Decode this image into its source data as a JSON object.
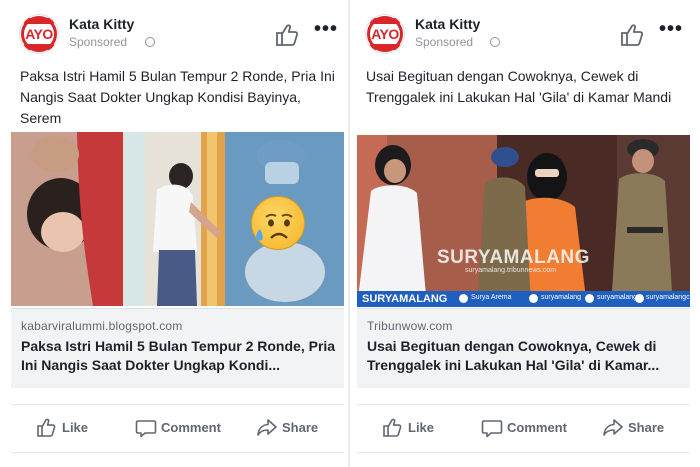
{
  "posts": [
    {
      "page_name": "Kata Kitty",
      "sponsored": "Sponsored",
      "avatar_text": "AYO",
      "caption": "Paksa Istri Hamil 5 Bulan Tempur 2 Ronde, Pria Ini Nangis Saat Dokter Ungkap Kondisi Bayinya, Serem",
      "link_domain": "kabarviralummi.blogspot.com",
      "link_title": "Paksa Istri Hamil 5 Bulan Tempur 2 Ronde, Pria Ini Nangis Saat Dokter Ungkap Kondi...",
      "actions": {
        "like": "Like",
        "comment": "Comment",
        "share": "Share"
      }
    },
    {
      "page_name": "Kata Kitty",
      "sponsored": "Sponsored",
      "avatar_text": "AYO",
      "caption": "Usai Begituan dengan Cowoknya, Cewek di Trenggalek ini Lakukan Hal 'Gila' di Kamar Mandi",
      "link_domain": "Tribunwow.com",
      "link_title": "Usai Begituan dengan Cowoknya, Cewek di Trenggalek ini Lakukan Hal 'Gila' di Kamar...",
      "watermark": "SURYAMALANG",
      "watermark_url": "suryamalang.tribunnews.com",
      "banner": {
        "brand": "SURYAMALANG",
        "facebook": "Surya Arema",
        "twitter": "suryamalang",
        "instagram": "suryamalang",
        "web": "suryamalangcom"
      },
      "actions": {
        "like": "Like",
        "comment": "Comment",
        "share": "Share"
      }
    }
  ],
  "colors": {
    "brand_red": "#d8262b",
    "text": "#1d2129",
    "secondary": "#90949c",
    "link_box": "#f2f3f5",
    "banner_blue": "#1f5fbf"
  },
  "icons": [
    "thumbs-up-icon",
    "more-horizontal-icon",
    "globe-icon",
    "comment-icon",
    "share-icon",
    "sad-face-emoji-icon"
  ]
}
